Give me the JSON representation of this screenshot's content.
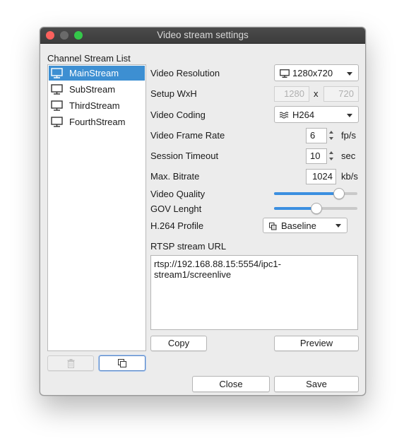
{
  "window": {
    "title": "Video stream settings"
  },
  "channels": {
    "heading": "Channel Stream List",
    "items": [
      {
        "label": "MainStream",
        "selected": true
      },
      {
        "label": "SubStream",
        "selected": false
      },
      {
        "label": "ThirdStream",
        "selected": false
      },
      {
        "label": "FourthStream",
        "selected": false
      }
    ],
    "delete_icon": "trash-icon",
    "duplicate_icon": "duplicate-icon"
  },
  "settings": {
    "video_resolution": {
      "label": "Video Resolution",
      "value": "1280x720",
      "icon": "monitor-icon"
    },
    "setup_wxh": {
      "label": "Setup WxH",
      "width": "1280",
      "separator": "x",
      "height": "720"
    },
    "video_coding": {
      "label": "Video Coding",
      "value": "H264",
      "icon": "waves-icon"
    },
    "frame_rate": {
      "label": "Video Frame Rate",
      "value": "6",
      "unit": "fp/s"
    },
    "session_timeout": {
      "label": "Session Timeout",
      "value": "10",
      "unit": "sec"
    },
    "max_bitrate": {
      "label": "Max. Bitrate",
      "value": "1024",
      "unit": "kb/s"
    },
    "video_quality": {
      "label": "Video Quality",
      "level": 0.77
    },
    "gov_length": {
      "label": "GOV Lenght",
      "level": 0.5
    },
    "h264_profile": {
      "label": "H.264 Profile",
      "value": "Baseline",
      "icon": "layers-icon"
    },
    "rtsp": {
      "label": "RTSP stream URL",
      "url": "rtsp://192.168.88.15:5554/ipc1-stream1/screenlive"
    }
  },
  "buttons": {
    "copy": "Copy",
    "preview": "Preview",
    "close": "Close",
    "save": "Save"
  },
  "colors": {
    "selection": "#3d8fd2",
    "slider_fill": "#3b8fe0",
    "close": "#fc615d",
    "maximize": "#34c84a"
  }
}
